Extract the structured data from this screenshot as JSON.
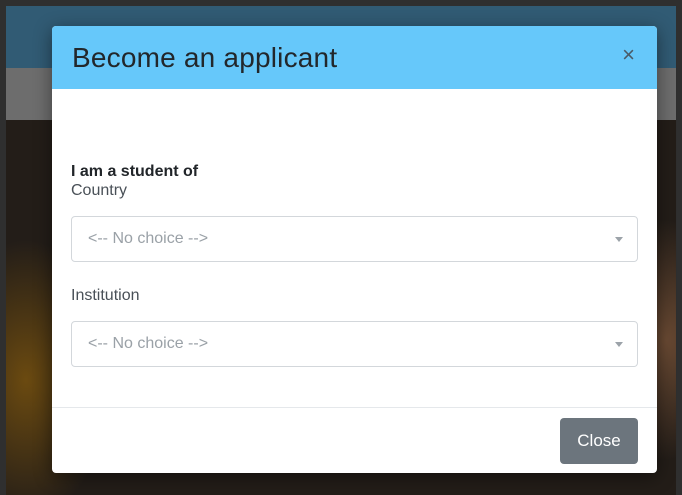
{
  "modal": {
    "title": "Become an applicant",
    "close_icon": "×",
    "section_heading": "I am a student of",
    "country": {
      "label": "Country",
      "selected": "<-- No choice -->"
    },
    "institution": {
      "label": "Institution",
      "selected": "<-- No choice -->"
    },
    "close_button_label": "Close"
  },
  "colors": {
    "header_bg": "#66c8fa",
    "close_button_bg": "#6c757d",
    "topbar_bg": "#315b74"
  },
  "icons": {
    "dismiss": "close-icon",
    "dropdown": "chevron-down-icon"
  }
}
